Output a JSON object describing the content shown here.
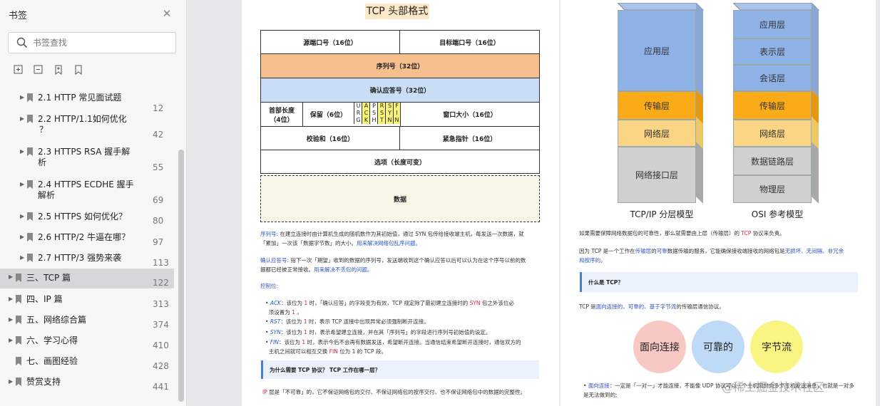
{
  "sidebar": {
    "title": "书签",
    "search_placeholder": "书签查找",
    "items": [
      {
        "label": "2.1 HTTP 常见面试题",
        "page": "12"
      },
      {
        "label": "2.2 HTTP/1.1如何优化",
        "label2": "？",
        "page": "42"
      },
      {
        "label": "2.3 HTTPS RSA 握手解",
        "label2": "析",
        "page": "55"
      },
      {
        "label": "2.4 HTTPS ECDHE 握手",
        "label2": "解析",
        "page": "69"
      },
      {
        "label": "2.5 HTTPS 如何优化？",
        "page": "80"
      },
      {
        "label": "2.6 HTTP/2 牛逼在哪？",
        "page": "97"
      },
      {
        "label": "2.7 HTTP/3 强势来袭",
        "page": "113"
      },
      {
        "label": "三、TCP 篇",
        "page": "122"
      },
      {
        "label": "四、IP 篇",
        "page": "313"
      },
      {
        "label": "五、网络综合篇",
        "page": "374"
      },
      {
        "label": "六、学习心得",
        "page": "410"
      },
      {
        "label": "七、画图经验",
        "page": "428"
      },
      {
        "label": "赞赏支持",
        "page": "441"
      }
    ]
  },
  "page1": {
    "title": "TCP 头部格式",
    "header": {
      "src_port": "源端口号（16位）",
      "dst_port": "目标端口号（16位）",
      "seq": "序列号（32位）",
      "ack": "确认应答号（32位）",
      "hdr_len": "首部长度",
      "hdr_len2": "（4位）",
      "reserved": "保留（6位）",
      "flags": [
        [
          "U",
          "R",
          "G"
        ],
        [
          "A",
          "C",
          "K"
        ],
        [
          "P",
          "S",
          "H"
        ],
        [
          "R",
          "S",
          "T"
        ],
        [
          "S",
          "Y",
          "N"
        ],
        [
          "F",
          "I",
          "N"
        ]
      ],
      "window": "窗口大小（16位）",
      "checksum": "校验和（16位）",
      "urgent": "紧急指针（16位）",
      "options": "选项（长度可变）",
      "data": "数据"
    },
    "p_seq_label": "序列号:",
    "p_seq_text": " 在建立连接时由计算机生成的随机数作为其初始值，通过 SYN 包传给接收端主机，每发送一次数据，就",
    "p_seq_text2": "「累加」一次该「数据字节数」的大小。",
    "p_seq_link": "用来解决网络包乱序问题。",
    "p_ack_label": "确认应答号:",
    "p_ack_text": " 指下一次「期望」收到的数据的序列号，发送端收到这个确认应答以后可以认为在这个序号以前的数",
    "p_ack_text2": "据都已经被正常接收。",
    "p_ack_link": "用来解决不丢包的问题。",
    "ctrl_label": "控制位:",
    "bullets": [
      {
        "k": "ACK",
        "a": "：该位为 ",
        "v": "1",
        "b": " 时，「确认应答」的字段变为有效，TCP 规定除了最初建立连接时的 ",
        "s": "SYN",
        "c": " 包之外该位必",
        "line2": "须设置为 ",
        "v2": "1",
        "end": " 。"
      },
      {
        "k": "RST",
        "a": "：该位为 ",
        "v": "1",
        "b": " 时，表示 TCP 连接中出现异常必须强制断开连接。"
      },
      {
        "k": "SYN",
        "a": "：该位为 ",
        "v": "1",
        "b": " 时，表示希望建立连接，并在其「序列号」的字段进行序列号初始值的设定。"
      },
      {
        "k": "FIN",
        "a": "：该位为 ",
        "v": "1",
        "b": " 时，表示今后不会再有数据发送，希望断开连接。当通信结束希望断开连接时，通信双方的",
        "line2": "主机之间就可以相互交换 ",
        "v2": "FIN",
        "end": " 位为 1 的 TCP 段。"
      }
    ],
    "callout": "为什么需要 TCP 协议？ TCP 工作在哪一层？",
    "ip_label": "IP",
    "ip_text": " 层是「不可靠」的，它不保证网络包的交付、不保证网络包的按序交付、也不保证网络包中的数据的完整性。"
  },
  "page2": {
    "tcpip_layers": [
      "应用层",
      "传输层",
      "网络层",
      "网络接口层"
    ],
    "osi_layers": [
      "应用层",
      "表示层",
      "会话层",
      "传输层",
      "网络层",
      "数据链路层",
      "物理层"
    ],
    "tcpip_caption": "TCP/IP 分层模型",
    "osi_caption": "OSI 参考模型",
    "p1_a": "如果需要保障网络数据包的可靠性，那么就需要由上层（传输层）的 ",
    "p1_tcp": "TCP",
    "p1_b": " 协议来负责。",
    "p2_a": "因为 TCP 是一个工作在",
    "p2_l1": "传输层",
    "p2_b": "的",
    "p2_l2": "可靠",
    "p2_c": "数据传输的服务，它能确保接收端接收的网络包是",
    "p2_l3": "无损坏、无间隔、非冗余",
    "p2_d": "和按序的",
    "p2_e": "。",
    "callout": "什么是 TCP？",
    "p3_a": "TCP 是",
    "p3_l": "面向连接的、可靠的、基于字节流",
    "p3_b": "的传输层通信协议。",
    "circles": [
      "面向连接",
      "可靠的",
      "字节流"
    ],
    "bullet_k": "面向连接",
    "bullet_a": "：一定是「一对一」才能连接，不能像 UDP 协议可以一个主机同时向多个主机发送消息，也就是一对多是无法做到的;",
    "bullet_line2": "对多是无法做到的;"
  },
  "watermark": "@稀土掘金技术社区"
}
